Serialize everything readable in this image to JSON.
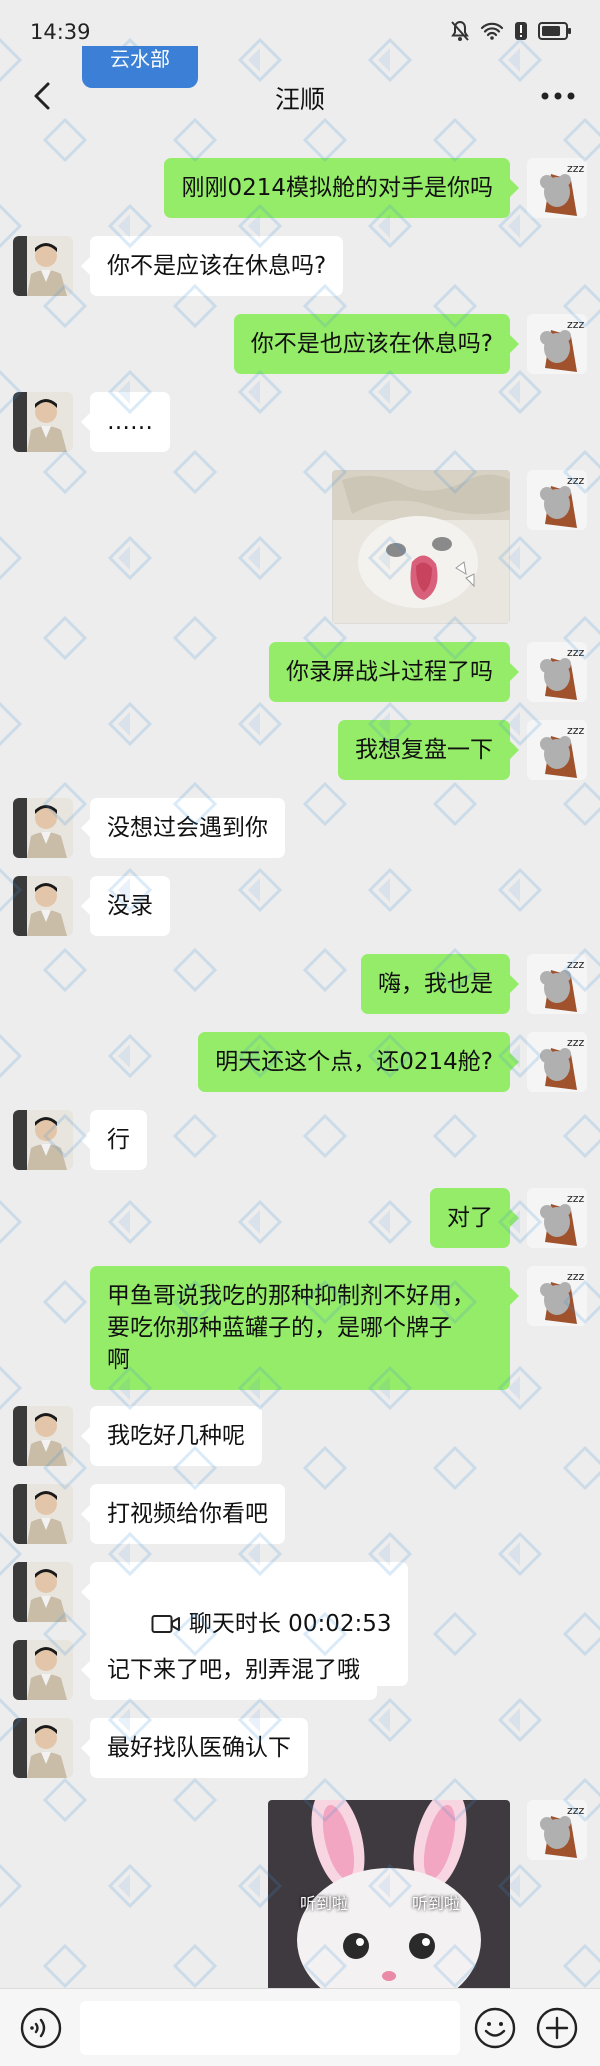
{
  "status_bar": {
    "time": "14:39"
  },
  "header": {
    "title": "汪顺",
    "floating_tag": "云水部"
  },
  "colors": {
    "background": "#ededed",
    "outgoing_bubble": "#95ec69",
    "incoming_bubble": "#ffffff",
    "floating_tag": "#3b7fd6"
  },
  "messages": [
    {
      "side": "out",
      "type": "text",
      "text": "刚刚0214模拟舱的对手是你吗"
    },
    {
      "side": "in",
      "type": "text",
      "text": "你不是应该在休息吗?"
    },
    {
      "side": "out",
      "type": "text",
      "text": "你不是也应该在休息吗?"
    },
    {
      "side": "in",
      "type": "text",
      "text": "……"
    },
    {
      "side": "out",
      "type": "sticker",
      "icon": "cat-sticker"
    },
    {
      "side": "out",
      "type": "text",
      "text": "你录屏战斗过程了吗"
    },
    {
      "side": "out",
      "type": "text",
      "text": "我想复盘一下"
    },
    {
      "side": "in",
      "type": "text",
      "text": "没想过会遇到你"
    },
    {
      "side": "in",
      "type": "text",
      "text": "没录"
    },
    {
      "side": "out",
      "type": "text",
      "text": "嗨，我也是"
    },
    {
      "side": "out",
      "type": "text",
      "text": "明天还这个点，还0214舱?"
    },
    {
      "side": "in",
      "type": "text",
      "text": "行"
    },
    {
      "side": "out",
      "type": "text",
      "text": "对了"
    },
    {
      "side": "out",
      "type": "text",
      "text": "甲鱼哥说我吃的那种抑制剂不好用，\n要吃你那种蓝罐子的，是哪个牌子\n啊"
    },
    {
      "side": "in",
      "type": "text",
      "text": "我吃好几种呢"
    },
    {
      "side": "in",
      "type": "text",
      "text": "打视频给你看吧"
    },
    {
      "side": "in",
      "type": "call",
      "text": "聊天时长 00:02:53",
      "icon": "video-call-icon"
    },
    {
      "side": "in",
      "type": "text",
      "text": "记下来了吧，别弄混了哦"
    },
    {
      "side": "in",
      "type": "text",
      "text": "最好找队医确认下"
    },
    {
      "side": "out",
      "type": "sticker",
      "icon": "bunny-cat-sticker",
      "captions": [
        "听到啦",
        "听到啦"
      ]
    }
  ],
  "input_bar": {
    "placeholder": "",
    "icons": [
      "voice-icon",
      "emoji-icon",
      "plus-icon"
    ]
  }
}
